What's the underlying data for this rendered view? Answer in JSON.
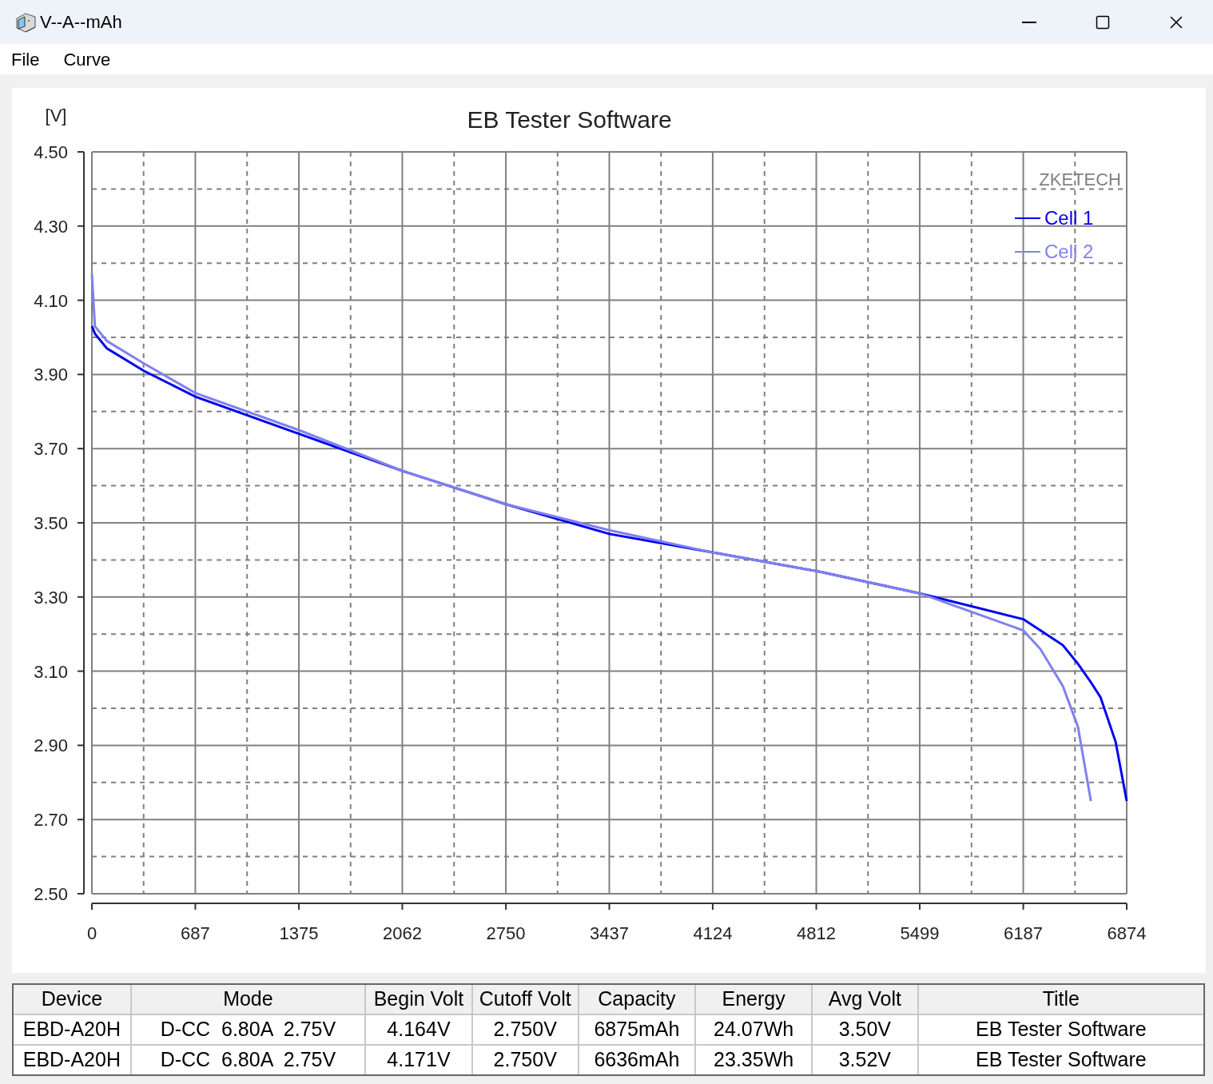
{
  "window": {
    "title": "V--A--mAh"
  },
  "menu": [
    "File",
    "Curve"
  ],
  "chart": {
    "brand": "ZKETECH",
    "chart_data": {
      "type": "line",
      "title": "EB Tester Software",
      "ylabel": "[V]",
      "x": [
        0,
        20,
        100,
        344,
        687,
        1375,
        2062,
        2750,
        3437,
        4124,
        4812,
        5499,
        6187,
        6300,
        6450,
        6550,
        6636,
        6700,
        6800,
        6874
      ],
      "series": [
        {
          "name": "Cell 1",
          "color": "#0000ee",
          "values": [
            4.03,
            4.01,
            3.97,
            3.91,
            3.84,
            3.74,
            3.64,
            3.55,
            3.47,
            3.42,
            3.37,
            3.31,
            3.24,
            3.21,
            3.17,
            3.12,
            3.07,
            3.03,
            2.91,
            2.75
          ]
        },
        {
          "name": "Cell 2",
          "color": "#8080f0",
          "values": [
            4.17,
            4.03,
            3.99,
            3.93,
            3.85,
            3.75,
            3.64,
            3.55,
            3.48,
            3.42,
            3.37,
            3.31,
            3.21,
            3.16,
            3.06,
            2.95,
            2.75,
            null,
            null,
            null
          ]
        }
      ],
      "xlim": [
        0,
        6874
      ],
      "ylim": [
        2.5,
        4.5
      ],
      "grid": true,
      "legend": true,
      "xticks": [
        0,
        687,
        1375,
        2062,
        2750,
        3437,
        4124,
        4812,
        5499,
        6187,
        6874
      ],
      "yticks": [
        {
          "value": 2.5,
          "label": "2.50"
        },
        {
          "value": 2.7,
          "label": "2.70"
        },
        {
          "value": 2.9,
          "label": "2.90"
        },
        {
          "value": 3.1,
          "label": "3.10"
        },
        {
          "value": 3.3,
          "label": "3.30"
        },
        {
          "value": 3.5,
          "label": "3.50"
        },
        {
          "value": 3.7,
          "label": "3.70"
        },
        {
          "value": 3.9,
          "label": "3.90"
        },
        {
          "value": 4.1,
          "label": "4.10"
        },
        {
          "value": 4.3,
          "label": "4.30"
        },
        {
          "value": 4.5,
          "label": "4.50"
        }
      ]
    }
  },
  "table": {
    "columns": [
      "Device",
      "Mode",
      "Begin Volt",
      "Cutoff Volt",
      "Capacity",
      "Energy",
      "Avg Volt",
      "Title"
    ],
    "rows": [
      [
        "EBD-A20H",
        "D-CC  6.80A  2.75V",
        "4.164V",
        "2.750V",
        "6875mAh",
        "24.07Wh",
        "3.50V",
        "EB Tester Software"
      ],
      [
        "EBD-A20H",
        "D-CC  6.80A  2.75V",
        "4.171V",
        "2.750V",
        "6636mAh",
        "23.35Wh",
        "3.52V",
        "EB Tester Software"
      ]
    ]
  }
}
